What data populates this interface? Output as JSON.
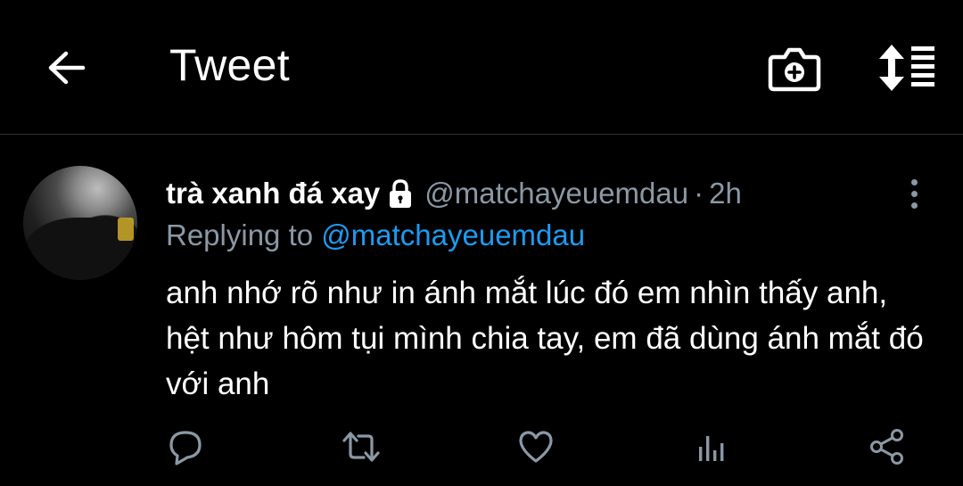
{
  "header": {
    "title": "Tweet",
    "icons": {
      "back": "arrow-left-icon",
      "camera": "camera-plus-icon",
      "sort": "sort-icon"
    }
  },
  "tweet": {
    "display_name": "trà xanh đá xay",
    "handle": "@matchayeuemdau",
    "separator": "·",
    "time": "2h",
    "replying_prefix": "Replying to",
    "replying_handle": "@matchayeuemdau",
    "text": "anh nhớ rõ như in ánh mắt lúc đó em nhìn thấy anh, hệt như hôm tụi mình chia tay, em đã dùng ánh mắt đó với anh",
    "protected": true
  },
  "actions": [
    "reply-icon",
    "retweet-icon",
    "like-icon",
    "analytics-icon",
    "share-icon"
  ],
  "colors": {
    "background": "#000000",
    "text": "#ffffff",
    "muted": "#8b98a5",
    "accent": "#1d9bf0",
    "divider": "#2f3336"
  }
}
